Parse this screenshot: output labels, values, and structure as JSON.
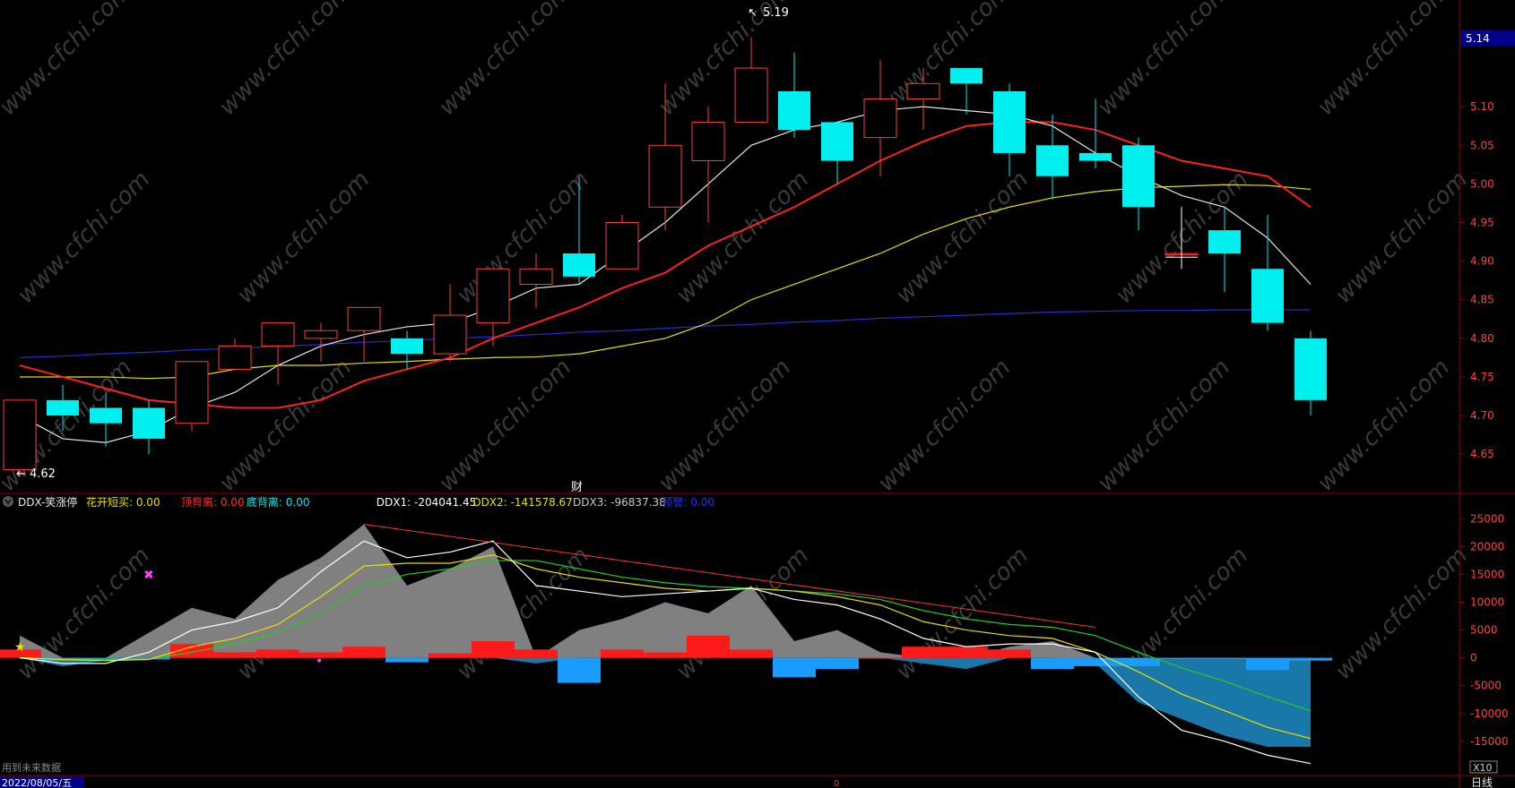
{
  "colors": {
    "up": "#ff3b3b",
    "down": "#00f0f0",
    "ma5": "#e8e8e8",
    "ma10": "#ff2020",
    "ma20": "#e8e000",
    "ma60": "#2030d0",
    "frame": "#8a0000",
    "axis_text": "#ff4040",
    "ddx_pos": "#ff1a1a",
    "ddx_neg": "#1a9cff",
    "gray_area": "#808080",
    "blue_area": "#1a78a8",
    "ddx1": "#ffffff",
    "ddx2": "#e8e000",
    "ddx3": "#20d020",
    "dark_line": "#ff3030"
  },
  "watermark": "www.cfchi.com",
  "price_panel": {
    "high_label": "5.19",
    "low_label": "4.62",
    "current_price": "5.14",
    "cai_marker": "财"
  },
  "indicator_header": {
    "name": "DDX-笑涨停",
    "items": [
      {
        "label": "花开短买: 0.00",
        "color": "#e8e000"
      },
      {
        "label": "顶背离: 0.00",
        "color": "#ff3030"
      },
      {
        "label": "底背离: 0.00",
        "color": "#00e8e8"
      },
      {
        "label": "DDX1: -204041.45",
        "color": "#ffffff"
      },
      {
        "label": "DDX2: -141578.67",
        "color": "#e8e000"
      },
      {
        "label": "DDX3: -96837.38",
        "color": "#c8c8c8"
      },
      {
        "label": "预警: 0.00",
        "color": "#2030ff"
      }
    ]
  },
  "footer": {
    "date": "2022/08/05/五",
    "note": "用到未来数据",
    "period": "日线",
    "zoom": "X10"
  },
  "chart_data": [
    {
      "type": "candlestick",
      "y_axis_ticks": [
        "5.10",
        "5.05",
        "5.00",
        "4.95",
        "4.90",
        "4.85",
        "4.80",
        "4.75",
        "4.70",
        "4.65"
      ],
      "ylim": [
        4.605,
        5.215
      ],
      "candles": [
        {
          "o": 4.63,
          "h": 4.72,
          "l": 4.62,
          "c": 4.72
        },
        {
          "o": 4.72,
          "h": 4.74,
          "l": 4.68,
          "c": 4.7
        },
        {
          "o": 4.71,
          "h": 4.73,
          "l": 4.66,
          "c": 4.69
        },
        {
          "o": 4.71,
          "h": 4.72,
          "l": 4.65,
          "c": 4.67
        },
        {
          "o": 4.69,
          "h": 4.77,
          "l": 4.68,
          "c": 4.77
        },
        {
          "o": 4.76,
          "h": 4.8,
          "l": 4.76,
          "c": 4.79
        },
        {
          "o": 4.79,
          "h": 4.82,
          "l": 4.74,
          "c": 4.82
        },
        {
          "o": 4.8,
          "h": 4.82,
          "l": 4.77,
          "c": 4.81
        },
        {
          "o": 4.81,
          "h": 4.84,
          "l": 4.77,
          "c": 4.84
        },
        {
          "o": 4.8,
          "h": 4.81,
          "l": 4.76,
          "c": 4.78
        },
        {
          "o": 4.78,
          "h": 4.87,
          "l": 4.77,
          "c": 4.83
        },
        {
          "o": 4.82,
          "h": 4.89,
          "l": 4.79,
          "c": 4.89
        },
        {
          "o": 4.87,
          "h": 4.91,
          "l": 4.84,
          "c": 4.89
        },
        {
          "o": 4.91,
          "h": 5.01,
          "l": 4.87,
          "c": 4.88
        },
        {
          "o": 4.89,
          "h": 4.96,
          "l": 4.89,
          "c": 4.95
        },
        {
          "o": 4.97,
          "h": 5.13,
          "l": 4.94,
          "c": 5.05
        },
        {
          "o": 5.03,
          "h": 5.1,
          "l": 4.95,
          "c": 5.08
        },
        {
          "o": 5.08,
          "h": 5.19,
          "l": 5.08,
          "c": 5.15
        },
        {
          "o": 5.12,
          "h": 5.17,
          "l": 5.06,
          "c": 5.07
        },
        {
          "o": 5.08,
          "h": 5.08,
          "l": 5.0,
          "c": 5.03
        },
        {
          "o": 5.06,
          "h": 5.16,
          "l": 5.01,
          "c": 5.11
        },
        {
          "o": 5.11,
          "h": 5.15,
          "l": 5.07,
          "c": 5.13
        },
        {
          "o": 5.15,
          "h": 5.15,
          "l": 5.09,
          "c": 5.13
        },
        {
          "o": 5.12,
          "h": 5.13,
          "l": 5.01,
          "c": 5.04
        },
        {
          "o": 5.05,
          "h": 5.09,
          "l": 4.98,
          "c": 5.01
        },
        {
          "o": 5.04,
          "h": 5.11,
          "l": 5.02,
          "c": 5.03
        },
        {
          "o": 5.05,
          "h": 5.06,
          "l": 4.94,
          "c": 4.97
        },
        {
          "o": 4.91,
          "h": 4.97,
          "l": 4.89,
          "c": 4.91
        },
        {
          "o": 4.94,
          "h": 4.97,
          "l": 4.86,
          "c": 4.91
        },
        {
          "o": 4.89,
          "h": 4.96,
          "l": 4.81,
          "c": 4.82
        },
        {
          "o": 4.8,
          "h": 4.81,
          "l": 4.7,
          "c": 4.72
        }
      ],
      "ma5": [
        4.7,
        4.67,
        4.665,
        4.68,
        4.71,
        4.73,
        4.765,
        4.79,
        4.805,
        4.815,
        4.82,
        4.84,
        4.865,
        4.87,
        4.91,
        4.95,
        5.0,
        5.05,
        5.07,
        5.08,
        5.095,
        5.1,
        5.095,
        5.09,
        5.075,
        5.04,
        5.01,
        4.985,
        4.97,
        4.93,
        4.87
      ],
      "ma10": [
        4.765,
        4.75,
        4.735,
        4.72,
        4.715,
        4.71,
        4.71,
        4.72,
        4.745,
        4.76,
        4.775,
        4.8,
        4.82,
        4.84,
        4.865,
        4.885,
        4.92,
        4.945,
        4.97,
        5.0,
        5.03,
        5.055,
        5.075,
        5.08,
        5.08,
        5.07,
        5.05,
        5.03,
        5.02,
        5.01,
        4.97
      ],
      "ma20": [
        4.75,
        4.75,
        4.75,
        4.748,
        4.75,
        4.76,
        4.765,
        4.765,
        4.768,
        4.77,
        4.773,
        4.775,
        4.776,
        4.78,
        4.79,
        4.8,
        4.82,
        4.85,
        4.87,
        4.89,
        4.91,
        4.935,
        4.955,
        4.97,
        4.982,
        4.99,
        4.995,
        4.997,
        4.999,
        4.998,
        4.993
      ],
      "ma60": [
        4.775,
        4.777,
        4.78,
        4.782,
        4.785,
        4.787,
        4.79,
        4.792,
        4.795,
        4.797,
        4.8,
        4.802,
        4.805,
        4.808,
        4.81,
        4.813,
        4.816,
        4.818,
        4.821,
        4.823,
        4.826,
        4.828,
        4.83,
        4.832,
        4.834,
        4.835,
        4.836,
        4.836,
        4.837,
        4.837,
        4.837
      ],
      "crosshair_candle": 27
    },
    {
      "type": "area",
      "title": "DDX-笑涨停",
      "y_axis_ticks": [
        "25000",
        "20000",
        "15000",
        "10000",
        "5000",
        "0",
        "-5000",
        "-10000",
        "-15000"
      ],
      "ylim": [
        -20500,
        26500
      ],
      "bars": [
        1500,
        -500,
        -500,
        -300,
        2500,
        1000,
        1500,
        1000,
        2000,
        -800,
        800,
        3000,
        1500,
        -4500,
        1500,
        1000,
        4000,
        1500,
        -3500,
        -2000,
        0,
        2000,
        2000,
        1500,
        -2000,
        -1500,
        -1500,
        -200,
        -200,
        -2200,
        -500
      ],
      "gray": [
        4000,
        -1500,
        -500,
        4500,
        9000,
        7000,
        14000,
        18000,
        24000,
        13000,
        16000,
        20000,
        -1000,
        5000,
        7000,
        10000,
        8000,
        13000,
        3000,
        5000,
        1000,
        -1000,
        -2000,
        2000,
        3000,
        -1000,
        -8000,
        -11000,
        -14000,
        -16000,
        -16000
      ],
      "ddx1": [
        0,
        -1000,
        -1000,
        1000,
        5000,
        6500,
        9000,
        15500,
        21000,
        18000,
        19000,
        21000,
        13000,
        12000,
        11000,
        11500,
        12000,
        12500,
        10500,
        9500,
        7000,
        3500,
        2000,
        2500,
        2500,
        1000,
        -7000,
        -13000,
        -15000,
        -17500,
        -19000
      ],
      "ddx2": [
        0,
        -300,
        -500,
        -300,
        2000,
        3500,
        6000,
        11000,
        16500,
        17000,
        17000,
        18500,
        16000,
        14500,
        13500,
        12500,
        12000,
        12500,
        12000,
        11000,
        9500,
        6500,
        5000,
        4000,
        3500,
        1000,
        -2500,
        -6500,
        -9500,
        -12500,
        -14500
      ],
      "ddx3": [
        0,
        -200,
        -300,
        -200,
        1000,
        2500,
        4500,
        8000,
        13000,
        15000,
        16000,
        17500,
        17500,
        16000,
        14500,
        13500,
        12800,
        12500,
        12000,
        11500,
        10500,
        8500,
        7000,
        6000,
        5500,
        4000,
        1000,
        -1800,
        -4200,
        -7000,
        -9500
      ],
      "dark_line": [
        [
          8,
          24000
        ],
        [
          25,
          5500
        ]
      ],
      "markers": [
        {
          "candle": 0,
          "value": 2000,
          "glyph": "★",
          "color": "#e8e000"
        },
        {
          "candle": 3,
          "value": 15000,
          "glyph": "✖",
          "color": "#ff40ff"
        },
        {
          "candle": 7,
          "value": -500,
          "glyph": "•",
          "color": "#ff40ff"
        }
      ]
    }
  ]
}
